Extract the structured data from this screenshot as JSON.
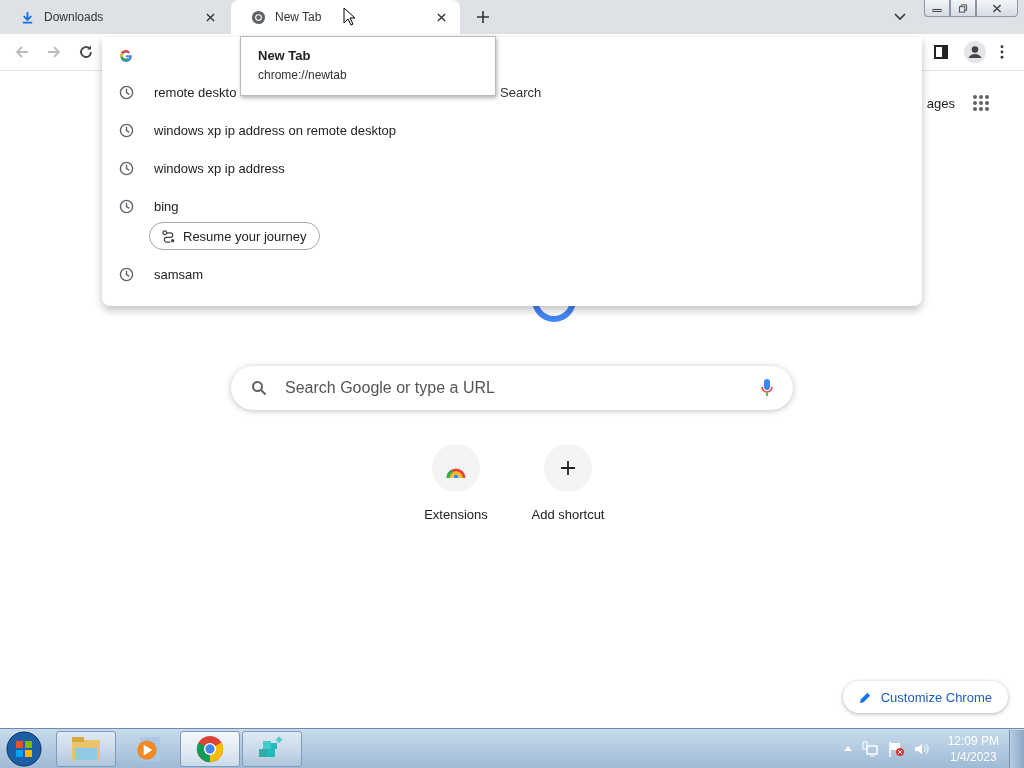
{
  "tabs": [
    {
      "title": "Downloads",
      "selected": false
    },
    {
      "title": "New Tab",
      "selected": true
    }
  ],
  "tooltip": {
    "title": "New Tab",
    "url": "chrome://newtab"
  },
  "suggestions": [
    {
      "kind": "history",
      "text": "remote deskto",
      "tail": "Search"
    },
    {
      "kind": "history",
      "text": "windows xp ip address on remote desktop"
    },
    {
      "kind": "history",
      "text": "windows xp ip address"
    },
    {
      "kind": "history",
      "text": "bing"
    },
    {
      "kind": "chip",
      "text": "Resume your journey"
    },
    {
      "kind": "history",
      "text": "samsam"
    }
  ],
  "images_link": "ages",
  "search": {
    "placeholder": "Search Google or type a URL"
  },
  "shortcuts": [
    {
      "label": "Extensions"
    },
    {
      "label": "Add shortcut"
    }
  ],
  "customize": "Customize Chrome",
  "taskbar": {
    "apps": [
      {
        "running": true,
        "selected": false
      },
      {
        "running": false,
        "selected": false
      },
      {
        "running": true,
        "selected": true
      },
      {
        "running": true,
        "selected": false
      }
    ],
    "time": "12:09 PM",
    "date": "1/4/2023"
  }
}
